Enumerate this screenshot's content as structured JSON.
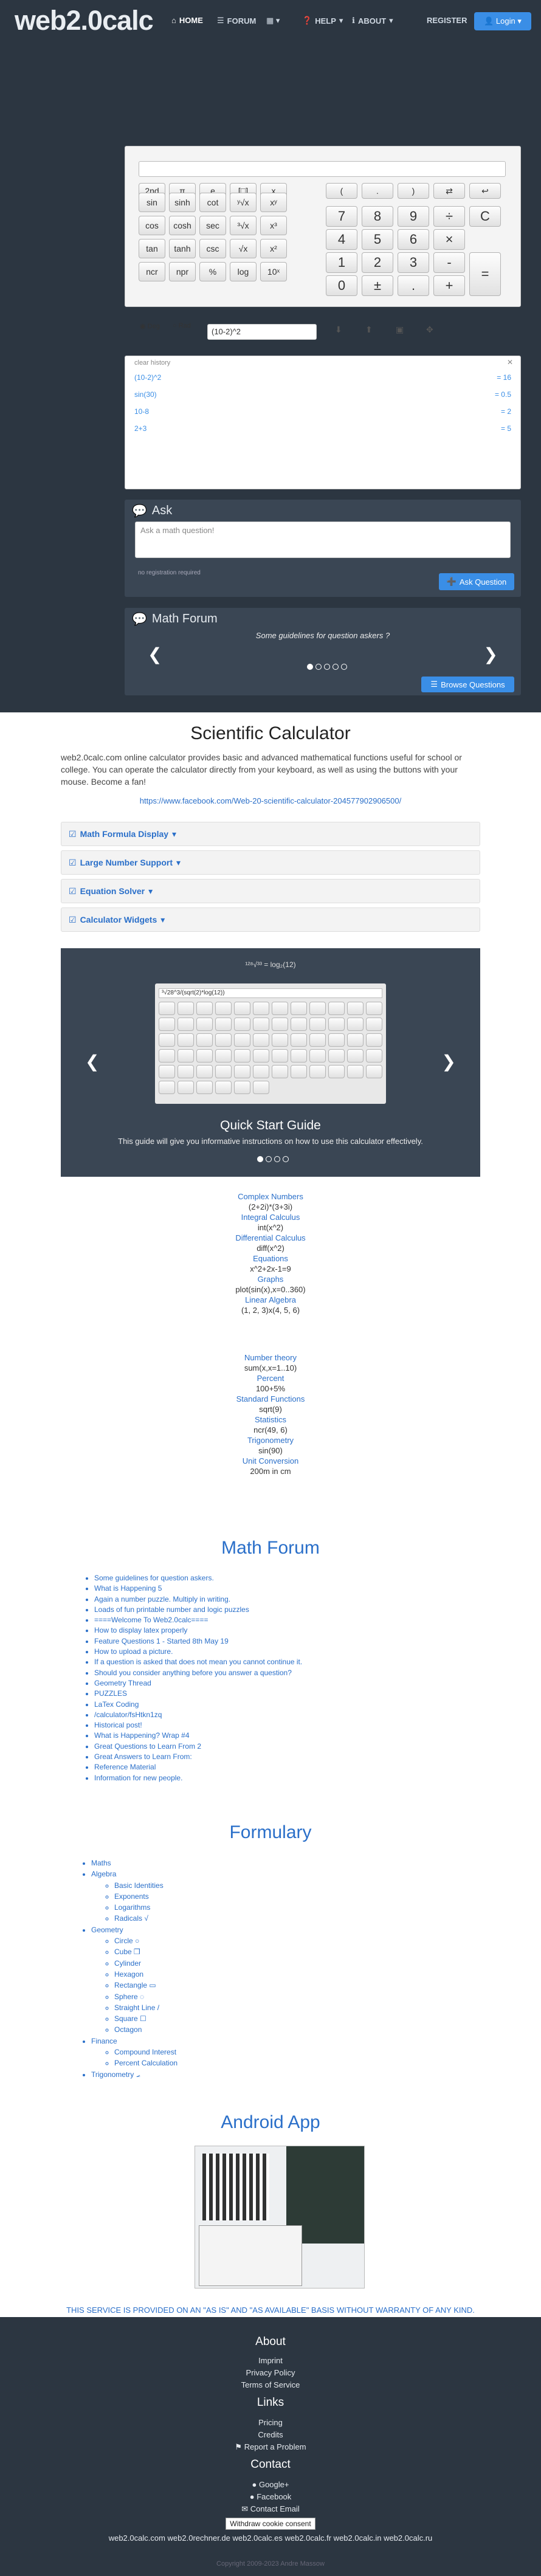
{
  "logo": "web2.0calc",
  "nav": {
    "home": "HOME",
    "forum": "FORUM",
    "apps": "",
    "help": "HELP",
    "about": "ABOUT",
    "register": "REGISTER",
    "login": "Login"
  },
  "calc": {
    "small_keys": [
      "2nd",
      "π",
      "e",
      "[□]",
      "x",
      "(",
      ".",
      ")",
      "⇄",
      "↩",
      "sin",
      "sinh",
      "cot",
      "ʸ√x",
      "xʸ",
      "cos",
      "cosh",
      "sec",
      "³√x",
      "x³",
      "tan",
      "tanh",
      "csc",
      "√x",
      "x²",
      "ncr",
      "npr",
      "%",
      "log",
      "10ˣ"
    ],
    "big_keys": [
      "7",
      "8",
      "9",
      "÷",
      "C",
      "4",
      "5",
      "6",
      "×",
      "1",
      "2",
      "3",
      "-",
      "=",
      "0",
      "±",
      ".",
      "+"
    ],
    "deg": "Deg",
    "rad": "Rad",
    "expression": "(10-2)^2"
  },
  "history": {
    "clear": "clear history",
    "rows": [
      {
        "expr": "(10-2)^2",
        "res": "= 16"
      },
      {
        "expr": "sin(30)",
        "res": "= 0.5"
      },
      {
        "expr": "10-8",
        "res": "= 2"
      },
      {
        "expr": "2+3",
        "res": "= 5"
      }
    ]
  },
  "ask": {
    "title": "Ask",
    "placeholder": "Ask a math question!",
    "note": "no registration required",
    "button": "Ask Question"
  },
  "forum_panel": {
    "title": "Math Forum",
    "slide": "Some guidelines for question askers ?",
    "button": "Browse Questions"
  },
  "page": {
    "title": "Scientific Calculator",
    "intro": "web2.0calc.com online calculator provides basic and advanced mathematical functions useful for school or college. You can operate the calculator directly from your keyboard, as well as using the buttons with your mouse. Become a fan!",
    "fb": "https://www.facebook.com/Web-20-scientific-calculator-204577902906500/"
  },
  "accordions": [
    "Math Formula Display",
    "Large Number Support",
    "Equation Solver",
    "Calculator Widgets"
  ],
  "guide": {
    "title": "Quick Start Guide",
    "text": "This guide will give you informative instructions on how to use this calculator effectively.",
    "formula": "¹²⁸√³³ = log₂(12)",
    "mini_expr": "³√28^3/(sqrt(2)*log(12))"
  },
  "examples": [
    {
      "cat": "Complex Numbers",
      "val": "(2+2i)*(3+3i)"
    },
    {
      "cat": "Integral Calculus",
      "val": "int(x^2)"
    },
    {
      "cat": "Differential Calculus",
      "val": "diff(x^2)"
    },
    {
      "cat": "Equations",
      "val": "x^2+2x-1=9"
    },
    {
      "cat": "Graphs",
      "val": "plot(sin(x),x=0..360)"
    },
    {
      "cat": "Linear Algebra",
      "val": "(1, 2, 3)x(4, 5, 6)"
    },
    {
      "cat": "Number theory",
      "val": "sum(x,x=1..10)"
    },
    {
      "cat": "Percent",
      "val": "100+5%"
    },
    {
      "cat": "Standard Functions",
      "val": "sqrt(9)"
    },
    {
      "cat": "Statistics",
      "val": "ncr(49, 6)"
    },
    {
      "cat": "Trigonometry",
      "val": "sin(90)"
    },
    {
      "cat": "Unit Conversion",
      "val": "200m in cm"
    }
  ],
  "forum": {
    "title": "Math Forum",
    "links": [
      "Some guidelines for question askers.",
      "What is Happening 5",
      "Again a number puzzle. Multiply in writing.",
      "Loads of fun printable number and logic puzzles",
      "====Welcome To Web2.0calc====",
      "How to display latex properly",
      "Feature Questions 1 - Started 8th May 19",
      "How to upload a picture.",
      "If a question is asked that does not mean you cannot continue it.",
      "Should you consider anything before you answer a question?",
      "Geometry Thread",
      "PUZZLES",
      "LaTex Coding",
      "/calculator/fsHtkn1zq",
      "Historical post!",
      "What is Happening? Wrap #4",
      "Great Questions to Learn From 2",
      "Great Answers to Learn From:",
      "Reference Material",
      "Information for new people."
    ]
  },
  "formulary": {
    "title": "Formulary",
    "maths": "Maths",
    "algebra": "Algebra",
    "algebra_items": [
      "Basic Identities",
      "Exponents",
      "Logarithms",
      "Radicals √"
    ],
    "geometry": "Geometry",
    "geometry_items": [
      "Circle ○",
      "Cube ❒",
      "Cylinder",
      "Hexagon",
      "Rectangle ▭",
      "Sphere ◌",
      "Straight Line /",
      "Square ☐",
      "Octagon"
    ],
    "finance": "Finance",
    "finance_items": [
      "Compound Interest",
      "Percent Calculation"
    ],
    "trig": "Trigonometry ⦟"
  },
  "android": {
    "title": "Android App"
  },
  "disclaimer": "THIS SERVICE IS PROVIDED ON AN \"AS IS\" AND \"AS AVAILABLE\" BASIS WITHOUT WARRANTY OF ANY KIND.",
  "footer": {
    "about": "About",
    "imprint": "Imprint",
    "privacy": "Privacy Policy",
    "terms": "Terms of Service",
    "links": "Links",
    "pricing": "Pricing",
    "credits": "Credits",
    "report": "Report a Problem",
    "contact": "Contact",
    "google": "Google+",
    "facebook": "Facebook",
    "email": "Contact Email",
    "consent": "Withdraw cookie consent",
    "domains": "web2.0calc.com web2.0rechner.de web2.0calc.es web2.0calc.fr web2.0calc.in web2.0calc.ru",
    "copyright": "Copyright 2009-2023 Andre Massow"
  }
}
